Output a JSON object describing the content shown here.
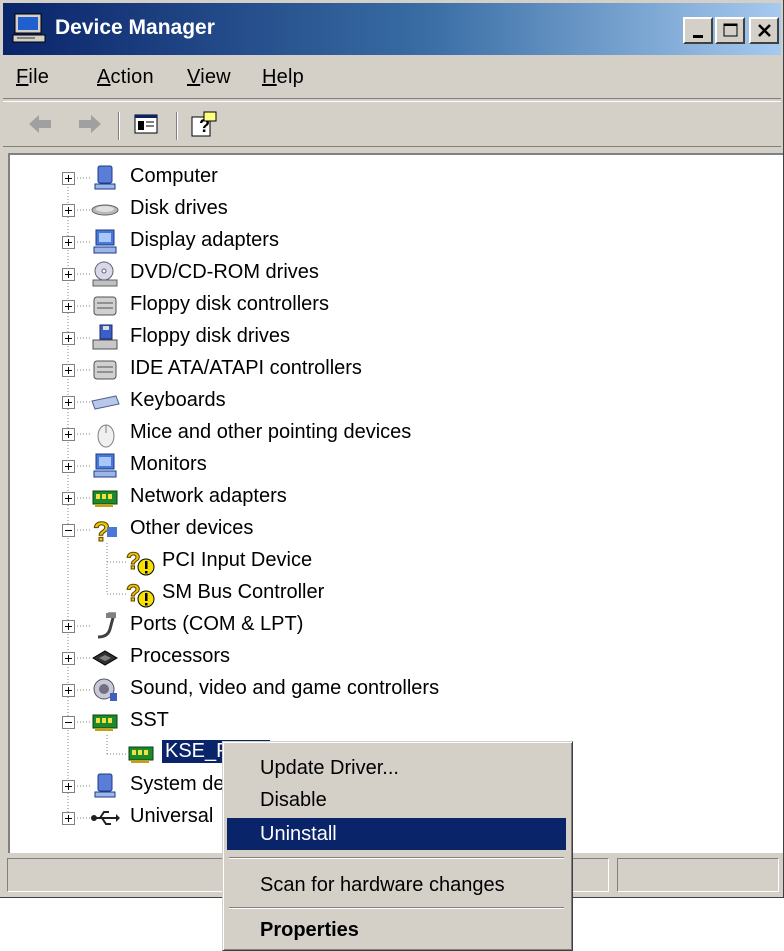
{
  "window": {
    "title": "Device Manager",
    "title_icon": "computer-icon"
  },
  "caption_buttons": [
    "minimize",
    "maximize",
    "close"
  ],
  "menu": [
    "File",
    "Action",
    "View",
    "Help"
  ],
  "toolbar": {
    "buttons": [
      "back-arrow-icon",
      "forward-arrow-icon",
      "properties-view-icon",
      "help-icon"
    ]
  },
  "tree": {
    "items": [
      {
        "label": "Computer",
        "icon": "computer-icon",
        "expander": "plus",
        "level": 0
      },
      {
        "label": "Disk drives",
        "icon": "disk-drive-icon",
        "expander": "plus",
        "level": 0
      },
      {
        "label": "Display adapters",
        "icon": "display-adapter-icon",
        "expander": "plus",
        "level": 0
      },
      {
        "label": "DVD/CD-ROM drives",
        "icon": "cdrom-icon",
        "expander": "plus",
        "level": 0
      },
      {
        "label": "Floppy disk controllers",
        "icon": "controller-icon",
        "expander": "plus",
        "level": 0
      },
      {
        "label": "Floppy disk drives",
        "icon": "floppy-drive-icon",
        "expander": "plus",
        "level": 0
      },
      {
        "label": "IDE ATA/ATAPI controllers",
        "icon": "controller-icon",
        "expander": "plus",
        "level": 0
      },
      {
        "label": "Keyboards",
        "icon": "keyboard-icon",
        "expander": "plus",
        "level": 0
      },
      {
        "label": "Mice and other pointing devices",
        "icon": "mouse-icon",
        "expander": "plus",
        "level": 0
      },
      {
        "label": "Monitors",
        "icon": "monitor-icon",
        "expander": "plus",
        "level": 0
      },
      {
        "label": "Network adapters",
        "icon": "network-card-icon",
        "expander": "plus",
        "level": 0
      },
      {
        "label": "Other devices",
        "icon": "unknown-device-icon",
        "expander": "minus",
        "level": 0
      },
      {
        "label": "PCI Input Device",
        "icon": "warning-device-icon",
        "expander": "none",
        "level": 1
      },
      {
        "label": "SM Bus Controller",
        "icon": "warning-device-icon",
        "expander": "none",
        "level": 1
      },
      {
        "label": "Ports (COM & LPT)",
        "icon": "port-icon",
        "expander": "plus",
        "level": 0
      },
      {
        "label": "Processors",
        "icon": "processor-icon",
        "expander": "plus",
        "level": 0
      },
      {
        "label": "Sound, video and game controllers",
        "icon": "sound-icon",
        "expander": "plus",
        "level": 0
      },
      {
        "label": "SST",
        "icon": "network-card-icon",
        "expander": "minus",
        "level": 0
      },
      {
        "label": "KSE_P",
        "icon": "network-card-icon",
        "expander": "none",
        "level": 1,
        "selected": true
      },
      {
        "label": "System de",
        "icon": "system-device-icon",
        "expander": "plus",
        "level": 0
      },
      {
        "label": "Universal",
        "icon": "usb-icon",
        "expander": "plus",
        "level": 0
      }
    ]
  },
  "context_menu": {
    "items": [
      {
        "label": "Update Driver...",
        "type": "item"
      },
      {
        "label": "Disable",
        "type": "item"
      },
      {
        "label": "Uninstall",
        "type": "item",
        "highlighted": true
      },
      {
        "label": "",
        "type": "separator"
      },
      {
        "label": "Scan for hardware changes",
        "type": "item"
      },
      {
        "label": "",
        "type": "separator"
      },
      {
        "label": "Properties",
        "type": "item",
        "bold": true
      }
    ]
  },
  "colors": {
    "title_start": "#0a246a",
    "title_end": "#a6caf0",
    "face": "#d4d0c8",
    "highlight": "#0a246a"
  }
}
